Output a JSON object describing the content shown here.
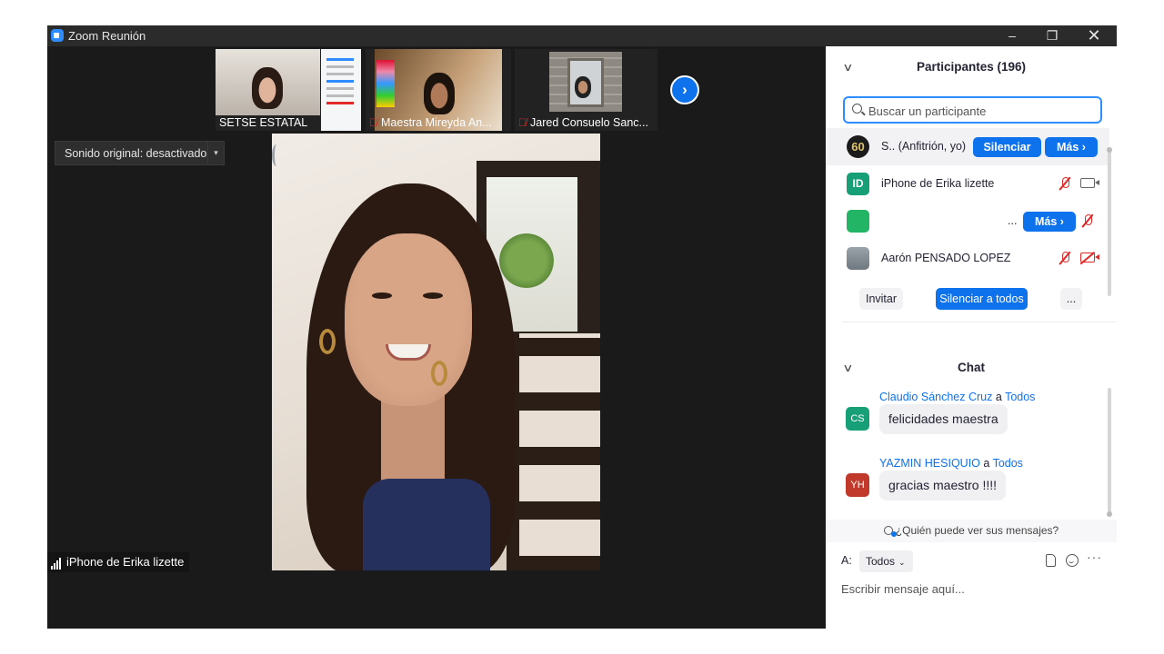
{
  "window": {
    "title": "Zoom Reunión",
    "minimize": "–",
    "maximize": "❐",
    "close": "✕"
  },
  "thumbnails": [
    {
      "name": "SETSE ESTATAL",
      "muted": false
    },
    {
      "name": "Maestra Mireyda An...",
      "muted": true
    },
    {
      "name": "Jared Consuelo Sanc...",
      "muted": true
    }
  ],
  "next_page_glyph": "›",
  "sound": {
    "label": "Sonido original: desactivado",
    "dropdown_glyph": "▾"
  },
  "main_speaker": {
    "name": "iPhone de Erika lizette"
  },
  "participants": {
    "title": "Participantes (196)",
    "collapse_glyph": "∨",
    "search_placeholder": "Buscar un participante",
    "list": [
      {
        "avatar_text": "60",
        "avatar_color": "#1b1b1b",
        "name": "S.. (Anfitrión, yo)",
        "button_mute": "Silenciar",
        "button_more": "Más ›"
      },
      {
        "avatar_text": "ID",
        "avatar_color": "#17a078",
        "name": "iPhone de Erika lizette"
      },
      {
        "avatar_text": "",
        "avatar_color": "#23b566",
        "name": "...",
        "button_more": "Más ›"
      },
      {
        "avatar_text": "",
        "avatar_color": "#8a8f96",
        "name": "Aarón PENSADO LOPEZ"
      }
    ],
    "invite": "Invitar",
    "mute_all": "Silenciar a todos",
    "more": "..."
  },
  "chat": {
    "title": "Chat",
    "messages": [
      {
        "sender": "Claudio Sánchez Cruz",
        "to_word": "a",
        "to": "Todos",
        "initials": "CS",
        "avatar_color": "#17a078",
        "text": "felicidades maestra"
      },
      {
        "sender": "YAZMIN HESIQUIO",
        "to_word": "a",
        "to": "Todos",
        "initials": "YH",
        "avatar_color": "#c0392b",
        "text": "gracias maestro !!!!"
      }
    ],
    "who_can_see": "¿Quién puede ver sus mensajes?",
    "to_label": "A:",
    "to_value": "Todos",
    "to_chevron": "⌄",
    "more_glyph": "···",
    "input_placeholder": "Escribir mensaje aquí..."
  }
}
